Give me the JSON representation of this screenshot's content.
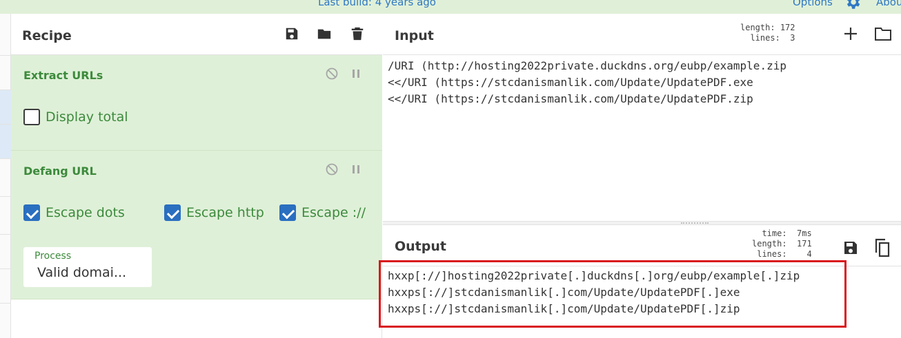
{
  "topbar": {
    "last_build": "Last build: 4 years ago",
    "options": "Options",
    "about": "Abou"
  },
  "recipe": {
    "title": "Recipe",
    "icons": [
      "save-icon",
      "folder-icon",
      "trash-icon"
    ],
    "operations": [
      {
        "name": "Extract URLs",
        "checkboxes": [
          {
            "label": "Display total",
            "checked": false
          }
        ]
      },
      {
        "name": "Defang URL",
        "checkboxes": [
          {
            "label": "Escape dots",
            "checked": true
          },
          {
            "label": "Escape http",
            "checked": true
          },
          {
            "label": "Escape ://",
            "checked": true
          }
        ],
        "process": {
          "label": "Process",
          "value": "Valid domai..."
        }
      }
    ]
  },
  "input": {
    "title": "Input",
    "length_label": "length:",
    "length": "172",
    "lines_label": "lines:",
    "lines": "3",
    "text": [
      "/URI (http://hosting2022private.duckdns.org/eubp/example.zip",
      "<</URI (https://stcdanismanlik.com/Update/UpdatePDF.exe",
      "<</URI (https://stcdanismanlik.com/Update/UpdatePDF.zip"
    ]
  },
  "output": {
    "title": "Output",
    "time_label": "time:",
    "time": "7ms",
    "length_label": "length:",
    "length": "171",
    "lines_label": "lines:",
    "lines": "4",
    "text": [
      "hxxp[://]hosting2022private[.]duckdns[.]org/eubp/example[.]zip",
      "hxxps[://]stcdanismanlik[.]com/Update/UpdatePDF[.]exe",
      "hxxps[://]stcdanismanlik[.]com/Update/UpdatePDF[.]zip"
    ]
  },
  "colors": {
    "operation_bg": "#dff0d8",
    "operation_text": "#3c8a3c",
    "checkbox_on": "#2a6fc0",
    "link": "#2f78c4",
    "highlight_border": "#d9161c"
  }
}
